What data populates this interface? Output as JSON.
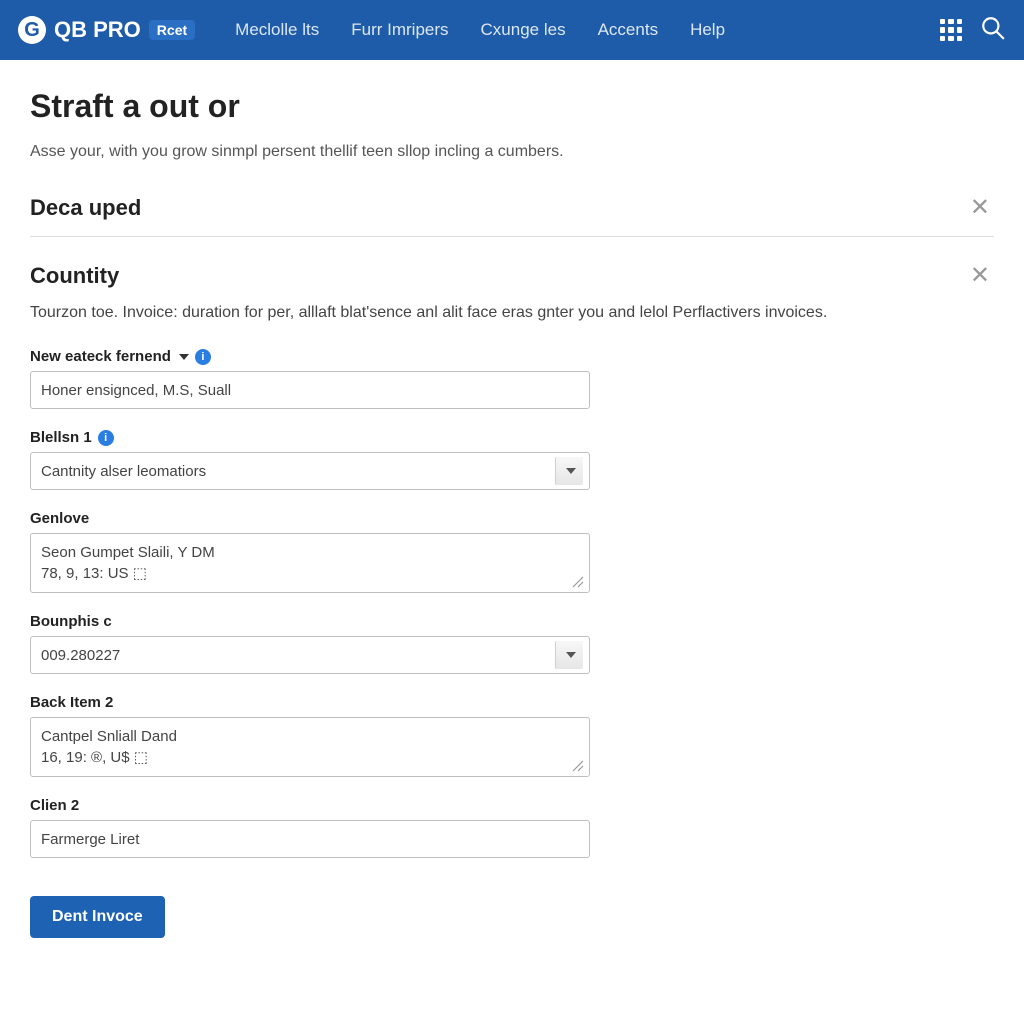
{
  "brand": {
    "logo_letter": "G",
    "name": "QB PRO",
    "badge": "Rcet"
  },
  "nav": {
    "items": [
      "Meclolle lts",
      "Furr Imripers",
      "Cxunge les",
      "Accents",
      "Help"
    ]
  },
  "page": {
    "title": "Straft a out or",
    "subtitle": "Asse your, with you grow sinmpl persent thellif teen sllop incling a cumbers."
  },
  "sections": {
    "a": {
      "title": "Deca uped"
    },
    "b": {
      "title": "Countity",
      "desc": "Tourzon toe. Invoice: duration for per, alllaft blat'sence anl alit face eras gnter you and lelol Perflactivers invoices."
    }
  },
  "form": {
    "f1": {
      "label": "New eateck fernend",
      "value": "Honer ensignced, M.S, Suall"
    },
    "f2": {
      "label": "Blellsn 1",
      "value": "Cantnity alser leomatiors"
    },
    "f3": {
      "label": "Genlove",
      "value": "Seon Gumpet Slaili, Y DM\n78, 9, 13: US ⬚"
    },
    "f4": {
      "label": "Bounphis c",
      "value": "009.280227"
    },
    "f5": {
      "label": "Back Item 2",
      "value": "Cantpel Snliall Dand\n16, 19: ®, U$ ⬚"
    },
    "f6": {
      "label": "Clien 2",
      "value": "Farmerge Liret"
    },
    "submit": "Dent Invoce"
  }
}
